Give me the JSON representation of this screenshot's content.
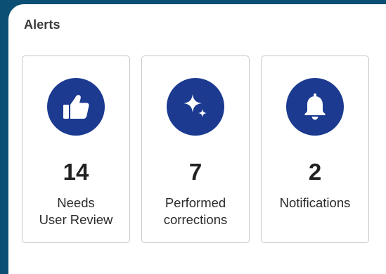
{
  "alerts": {
    "title": "Alerts",
    "icon_color": "#1b3a90",
    "background_color": "#0b4f74",
    "cards": [
      {
        "icon": "thumbs-up-icon",
        "count": "14",
        "label_line1": "Needs",
        "label_line2": "User Review"
      },
      {
        "icon": "sparkle-icon",
        "count": "7",
        "label_line1": "Performed",
        "label_line2": "corrections"
      },
      {
        "icon": "bell-icon",
        "count": "2",
        "label_line1": "Notifications",
        "label_line2": ""
      }
    ]
  }
}
